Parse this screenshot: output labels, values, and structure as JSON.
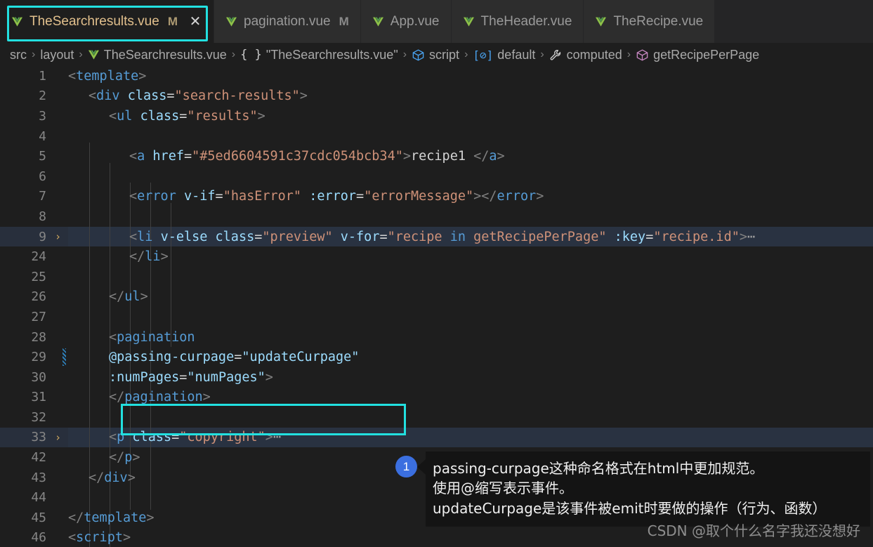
{
  "window": {
    "tabs": [
      {
        "label": "TheSearchresults.vue",
        "icon": "vue-icon",
        "modified_flag": "M",
        "active": true,
        "close_icon": "✕"
      },
      {
        "label": "pagination.vue",
        "icon": "vue-icon",
        "modified_flag": "M",
        "active": false,
        "close_icon": ""
      },
      {
        "label": "App.vue",
        "icon": "vue-icon",
        "modified_flag": "",
        "active": false,
        "close_icon": ""
      },
      {
        "label": "TheHeader.vue",
        "icon": "vue-icon",
        "modified_flag": "",
        "active": false,
        "close_icon": ""
      },
      {
        "label": "TheRecipe.vue",
        "icon": "vue-icon",
        "modified_flag": "",
        "active": false,
        "close_icon": ""
      }
    ]
  },
  "breadcrumb": {
    "separator": "›",
    "items": [
      {
        "label": "src",
        "icon": ""
      },
      {
        "label": "layout",
        "icon": ""
      },
      {
        "label": "TheSearchresults.vue",
        "icon": "vue-icon"
      },
      {
        "label": "\"TheSearchresults.vue\"",
        "icon": "braces-icon"
      },
      {
        "label": "script",
        "icon": "cube-blue-icon"
      },
      {
        "label": "default",
        "icon": "module-icon"
      },
      {
        "label": "computed",
        "icon": "wrench-icon"
      },
      {
        "label": "getRecipePerPage",
        "icon": "cube-purple-icon"
      }
    ]
  },
  "editor": {
    "lines": [
      {
        "num": "1",
        "fold": "",
        "selected": false,
        "modified": false,
        "indent": 0,
        "tokens": [
          {
            "c": "t-brack",
            "t": "<"
          },
          {
            "c": "t-tag",
            "t": "template"
          },
          {
            "c": "t-brack",
            "t": ">"
          }
        ]
      },
      {
        "num": "2",
        "fold": "",
        "selected": false,
        "modified": false,
        "indent": 1,
        "tokens": [
          {
            "c": "t-brack",
            "t": "<"
          },
          {
            "c": "t-tag",
            "t": "div"
          },
          {
            "c": "t-plain",
            "t": " "
          },
          {
            "c": "t-attr",
            "t": "class"
          },
          {
            "c": "t-eq",
            "t": "="
          },
          {
            "c": "t-str",
            "t": "\"search-results\""
          },
          {
            "c": "t-brack",
            "t": ">"
          }
        ]
      },
      {
        "num": "3",
        "fold": "",
        "selected": false,
        "modified": false,
        "indent": 2,
        "tokens": [
          {
            "c": "t-brack",
            "t": "<"
          },
          {
            "c": "t-tag",
            "t": "ul"
          },
          {
            "c": "t-plain",
            "t": " "
          },
          {
            "c": "t-attr",
            "t": "class"
          },
          {
            "c": "t-eq",
            "t": "="
          },
          {
            "c": "t-str",
            "t": "\"results\""
          },
          {
            "c": "t-brack",
            "t": ">"
          }
        ]
      },
      {
        "num": "4",
        "fold": "",
        "selected": false,
        "modified": false,
        "indent": 3,
        "tokens": []
      },
      {
        "num": "5",
        "fold": "",
        "selected": false,
        "modified": false,
        "indent": 3,
        "tokens": [
          {
            "c": "t-brack",
            "t": "<"
          },
          {
            "c": "t-tag",
            "t": "a"
          },
          {
            "c": "t-plain",
            "t": " "
          },
          {
            "c": "t-attr",
            "t": "href"
          },
          {
            "c": "t-eq",
            "t": "="
          },
          {
            "c": "t-str",
            "t": "\"#5ed6604591c37cdc054bcb34\""
          },
          {
            "c": "t-brack",
            "t": ">"
          },
          {
            "c": "t-txt",
            "t": "recipe1 "
          },
          {
            "c": "t-brack",
            "t": "</"
          },
          {
            "c": "t-tag",
            "t": "a"
          },
          {
            "c": "t-brack",
            "t": ">"
          }
        ]
      },
      {
        "num": "6",
        "fold": "",
        "selected": false,
        "modified": false,
        "indent": 3,
        "tokens": []
      },
      {
        "num": "7",
        "fold": "",
        "selected": false,
        "modified": false,
        "indent": 3,
        "tokens": [
          {
            "c": "t-brack",
            "t": "<"
          },
          {
            "c": "t-tag",
            "t": "error"
          },
          {
            "c": "t-plain",
            "t": " "
          },
          {
            "c": "t-attr",
            "t": "v-if"
          },
          {
            "c": "t-eq",
            "t": "="
          },
          {
            "c": "t-str",
            "t": "\"hasError\""
          },
          {
            "c": "t-plain",
            "t": " "
          },
          {
            "c": "t-attr",
            "t": ":error"
          },
          {
            "c": "t-eq",
            "t": "="
          },
          {
            "c": "t-str",
            "t": "\"errorMessage\""
          },
          {
            "c": "t-brack",
            "t": "></"
          },
          {
            "c": "t-tag",
            "t": "error"
          },
          {
            "c": "t-brack",
            "t": ">"
          }
        ]
      },
      {
        "num": "8",
        "fold": "",
        "selected": false,
        "modified": false,
        "indent": 3,
        "tokens": []
      },
      {
        "num": "9",
        "fold": "›",
        "selected": true,
        "modified": false,
        "indent": 3,
        "tokens": [
          {
            "c": "t-brack",
            "t": "<"
          },
          {
            "c": "t-tag",
            "t": "li"
          },
          {
            "c": "t-plain",
            "t": " "
          },
          {
            "c": "t-attr",
            "t": "v-else"
          },
          {
            "c": "t-plain",
            "t": " "
          },
          {
            "c": "t-attr",
            "t": "class"
          },
          {
            "c": "t-eq",
            "t": "="
          },
          {
            "c": "t-str",
            "t": "\"preview\""
          },
          {
            "c": "t-plain",
            "t": " "
          },
          {
            "c": "t-attr",
            "t": "v-for"
          },
          {
            "c": "t-eq",
            "t": "="
          },
          {
            "c": "t-str",
            "t": "\"recipe "
          },
          {
            "c": "t-tag",
            "t": "in"
          },
          {
            "c": "t-str",
            "t": " getRecipePerPage\""
          },
          {
            "c": "t-plain",
            "t": " "
          },
          {
            "c": "t-attr",
            "t": ":key"
          },
          {
            "c": "t-eq",
            "t": "="
          },
          {
            "c": "t-str",
            "t": "\"recipe.id\""
          },
          {
            "c": "t-brack",
            "t": ">"
          },
          {
            "c": "t-dots",
            "t": "⋯"
          }
        ]
      },
      {
        "num": "24",
        "fold": "",
        "selected": false,
        "modified": false,
        "indent": 3,
        "tokens": [
          {
            "c": "t-brack",
            "t": "</"
          },
          {
            "c": "t-tag",
            "t": "li"
          },
          {
            "c": "t-brack",
            "t": ">"
          }
        ]
      },
      {
        "num": "25",
        "fold": "",
        "selected": false,
        "modified": false,
        "indent": 3,
        "tokens": []
      },
      {
        "num": "26",
        "fold": "",
        "selected": false,
        "modified": false,
        "indent": 2,
        "tokens": [
          {
            "c": "t-brack",
            "t": "</"
          },
          {
            "c": "t-tag",
            "t": "ul"
          },
          {
            "c": "t-brack",
            "t": ">"
          }
        ]
      },
      {
        "num": "27",
        "fold": "",
        "selected": false,
        "modified": false,
        "indent": 2,
        "tokens": []
      },
      {
        "num": "28",
        "fold": "",
        "selected": false,
        "modified": false,
        "indent": 2,
        "tokens": [
          {
            "c": "t-brack",
            "t": "<"
          },
          {
            "c": "t-tag",
            "t": "pagination"
          }
        ]
      },
      {
        "num": "29",
        "fold": "",
        "selected": false,
        "modified": true,
        "indent": 2,
        "tokens": [
          {
            "c": "t-attr",
            "t": "@passing-curpage"
          },
          {
            "c": "t-eq",
            "t": "="
          },
          {
            "c": "t-attr",
            "t": "\"updateCurpage\""
          }
        ]
      },
      {
        "num": "30",
        "fold": "",
        "selected": false,
        "modified": false,
        "indent": 2,
        "tokens": [
          {
            "c": "t-attr",
            "t": ":numPages"
          },
          {
            "c": "t-eq",
            "t": "="
          },
          {
            "c": "t-attr",
            "t": "\"numPages\""
          },
          {
            "c": "t-brack",
            "t": ">"
          }
        ]
      },
      {
        "num": "31",
        "fold": "",
        "selected": false,
        "modified": false,
        "indent": 2,
        "tokens": [
          {
            "c": "t-brack",
            "t": "</"
          },
          {
            "c": "t-tag",
            "t": "pagination"
          },
          {
            "c": "t-brack",
            "t": ">"
          }
        ]
      },
      {
        "num": "32",
        "fold": "",
        "selected": false,
        "modified": false,
        "indent": 2,
        "tokens": []
      },
      {
        "num": "33",
        "fold": "›",
        "selected": true,
        "modified": false,
        "indent": 2,
        "tokens": [
          {
            "c": "t-brack",
            "t": "<"
          },
          {
            "c": "t-tag",
            "t": "p"
          },
          {
            "c": "t-plain",
            "t": " "
          },
          {
            "c": "t-attr",
            "t": "class"
          },
          {
            "c": "t-eq",
            "t": "="
          },
          {
            "c": "t-str",
            "t": "\"copyright\""
          },
          {
            "c": "t-brack",
            "t": ">"
          },
          {
            "c": "t-dots",
            "t": "⋯"
          }
        ]
      },
      {
        "num": "42",
        "fold": "",
        "selected": false,
        "modified": false,
        "indent": 2,
        "tokens": [
          {
            "c": "t-brack",
            "t": "</"
          },
          {
            "c": "t-tag",
            "t": "p"
          },
          {
            "c": "t-brack",
            "t": ">"
          }
        ]
      },
      {
        "num": "43",
        "fold": "",
        "selected": false,
        "modified": false,
        "indent": 1,
        "tokens": [
          {
            "c": "t-brack",
            "t": "</"
          },
          {
            "c": "t-tag",
            "t": "div"
          },
          {
            "c": "t-brack",
            "t": ">"
          }
        ]
      },
      {
        "num": "44",
        "fold": "",
        "selected": false,
        "modified": false,
        "indent": 1,
        "tokens": []
      },
      {
        "num": "45",
        "fold": "",
        "selected": false,
        "modified": false,
        "indent": 0,
        "tokens": [
          {
            "c": "t-brack",
            "t": "</"
          },
          {
            "c": "t-tag",
            "t": "template"
          },
          {
            "c": "t-brack",
            "t": ">"
          }
        ]
      },
      {
        "num": "46",
        "fold": "",
        "selected": false,
        "modified": false,
        "indent": 0,
        "tokens": [
          {
            "c": "t-brack",
            "t": "<"
          },
          {
            "c": "t-tag",
            "t": "script"
          },
          {
            "c": "t-brack",
            "t": ">"
          }
        ]
      }
    ]
  },
  "annotation": {
    "badge": "1",
    "lines": [
      "passing-curpage这种命名格式在html中更加规范。",
      "使用@缩写表示事件。",
      "updateCurpage是该事件被emit时要做的操作（行为、函数）"
    ]
  },
  "watermark": {
    "text": "CSDN @取个什么名字我还没想好"
  },
  "colors": {
    "accent_highlight": "#22e0e0",
    "editor_bg": "#1e1e1e",
    "tab_bg": "#2d2d2d",
    "tab_active_text": "#e2c08d",
    "badge_blue": "#3b6fe0",
    "tooltip_bg": "#141414",
    "tag": "#569cd6",
    "attr": "#9cdcfe",
    "string": "#ce9178",
    "selection_row": "#293241"
  }
}
